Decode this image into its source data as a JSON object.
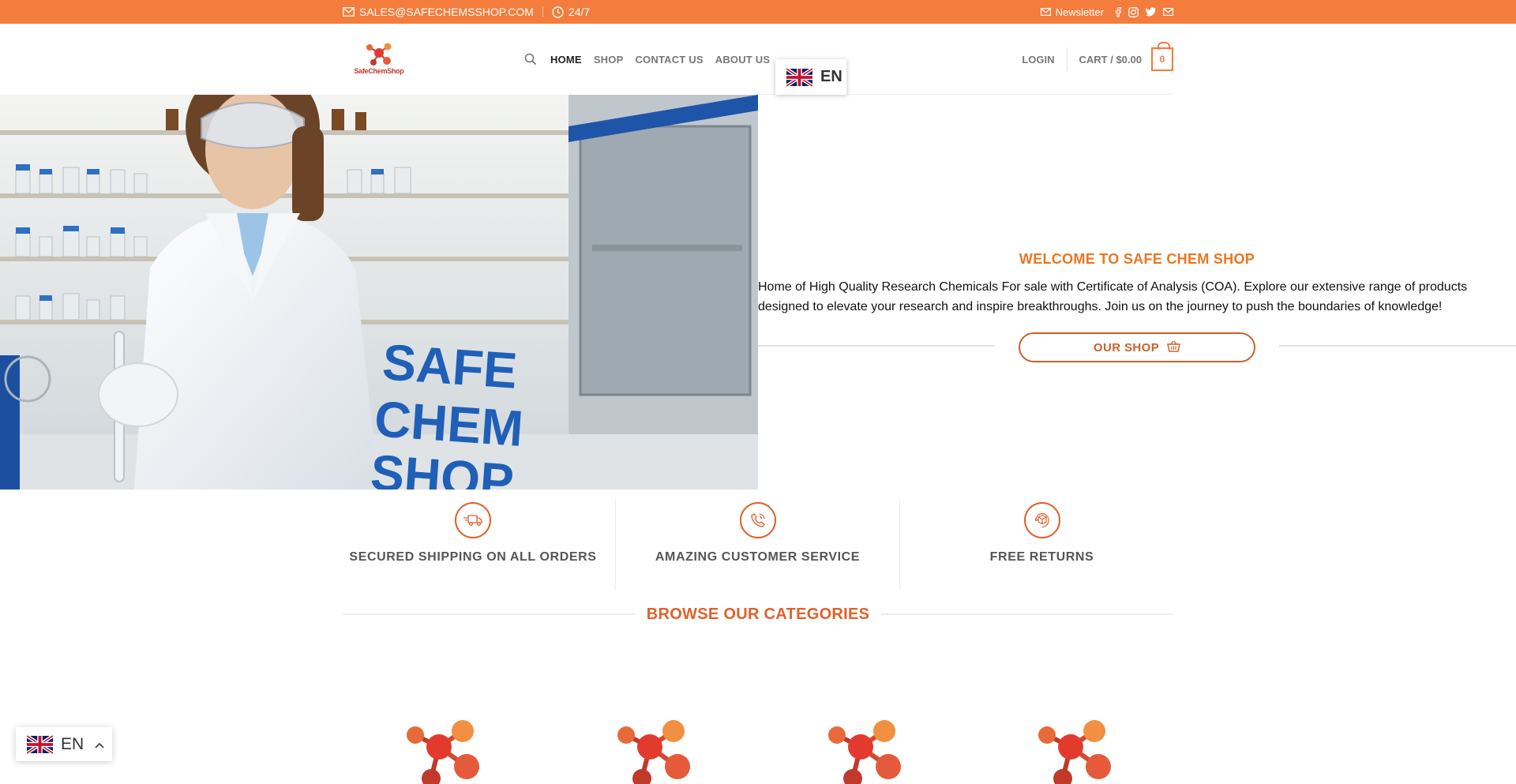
{
  "topbar": {
    "email": "SALES@SAFECHEMSSHOP.COM",
    "hours": "24/7",
    "newsletter": "Newsletter",
    "social": [
      "facebook-icon",
      "instagram-icon",
      "twitter-icon",
      "envelope-icon"
    ]
  },
  "header": {
    "logo_text": "SafeChemShop",
    "nav": [
      {
        "label": "HOME",
        "active": true
      },
      {
        "label": "SHOP",
        "active": false
      },
      {
        "label": "CONTACT US",
        "active": false
      },
      {
        "label": "ABOUT US",
        "active": false
      }
    ],
    "login": "LOGIN",
    "cart_label": "CART / $0.00",
    "cart_count": "0"
  },
  "language_popup": {
    "code": "EN"
  },
  "hero": {
    "image_text": [
      "SAFE",
      "CHEM",
      "SHOP"
    ],
    "title": "WELCOME TO SAFE CHEM SHOP",
    "description": "Home of High Quality Research Chemicals For sale with Certificate of Analysis (COA). Explore our extensive range of products designed to elevate your research and inspire breakthroughs. Join us on the journey to push the boundaries of knowledge!",
    "button": "OUR SHOP"
  },
  "features": [
    {
      "icon": "truck-icon",
      "label": "SECURED SHIPPING ON ALL ORDERS"
    },
    {
      "icon": "phone-icon",
      "label": "AMAZING CUSTOMER SERVICE"
    },
    {
      "icon": "return-box-icon",
      "label": "FREE RETURNS"
    }
  ],
  "categories": {
    "title": "BROWSE OUR CATEGORIES"
  },
  "language_switcher": {
    "code": "EN"
  },
  "colors": {
    "accent": "#f47c3c",
    "accent_dark": "#e0612a",
    "text": "#111111"
  }
}
